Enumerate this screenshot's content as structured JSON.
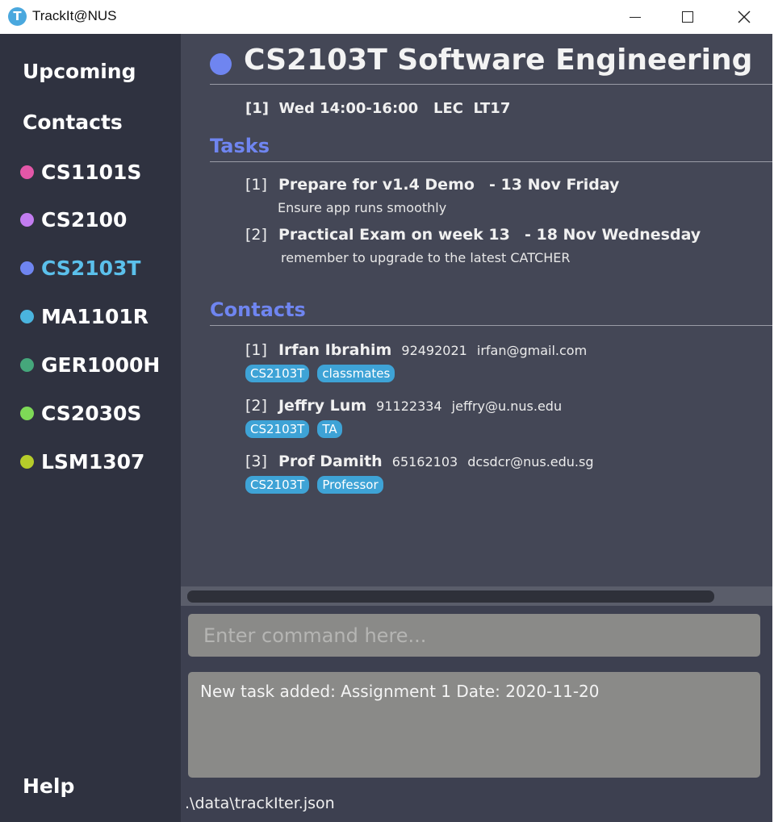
{
  "window": {
    "title": "TrackIt@NUS",
    "icon_letter": "T"
  },
  "sidebar": {
    "upcoming": "Upcoming",
    "contacts": "Contacts",
    "help": "Help",
    "modules": [
      {
        "code": "CS1101S",
        "color": "#e357a8",
        "active": false
      },
      {
        "code": "CS2100",
        "color": "#c27cf0",
        "active": false
      },
      {
        "code": "CS2103T",
        "color": "#6f85f0",
        "active": true
      },
      {
        "code": "MA1101R",
        "color": "#4ab4de",
        "active": false
      },
      {
        "code": "GER1000H",
        "color": "#45a77b",
        "active": false
      },
      {
        "code": "CS2030S",
        "color": "#7ed957",
        "active": false
      },
      {
        "code": "LSM1307",
        "color": "#b6cc2a",
        "active": false
      }
    ]
  },
  "module": {
    "title": "CS2103T Software Engineering",
    "color": "#6f85f0",
    "lesson": {
      "index": "[1]",
      "day": "Wed",
      "time": "14:00-16:00",
      "type": "LEC",
      "venue": "LT17"
    }
  },
  "tasks": {
    "heading": "Tasks",
    "items": [
      {
        "index": "[1]",
        "name": "Prepare for v1.4 Demo",
        "date": "- 13 Nov Friday",
        "remark": "Ensure app runs smoothly"
      },
      {
        "index": "[2]",
        "name": "Practical Exam on week 13",
        "date": "- 18 Nov Wednesday",
        "remark": "remember to upgrade to the latest CATCHER"
      }
    ]
  },
  "contacts": {
    "heading": "Contacts",
    "items": [
      {
        "index": "[1]",
        "name": "Irfan Ibrahim",
        "phone": "92492021",
        "email": "irfan@gmail.com",
        "tags": [
          "CS2103T",
          "classmates"
        ]
      },
      {
        "index": "[2]",
        "name": "Jeffry Lum",
        "phone": "91122334",
        "email": "jeffry@u.nus.edu",
        "tags": [
          "CS2103T",
          "TA"
        ]
      },
      {
        "index": "[3]",
        "name": "Prof Damith",
        "phone": "65162103",
        "email": "dcsdcr@nus.edu.sg",
        "tags": [
          "CS2103T",
          "Professor"
        ]
      }
    ]
  },
  "command": {
    "placeholder": "Enter command here...",
    "value": ""
  },
  "result": {
    "text": "New task added: Assignment 1 Date: 2020-11-20"
  },
  "status": {
    "file_path": ".\\data\\trackIter.json"
  }
}
